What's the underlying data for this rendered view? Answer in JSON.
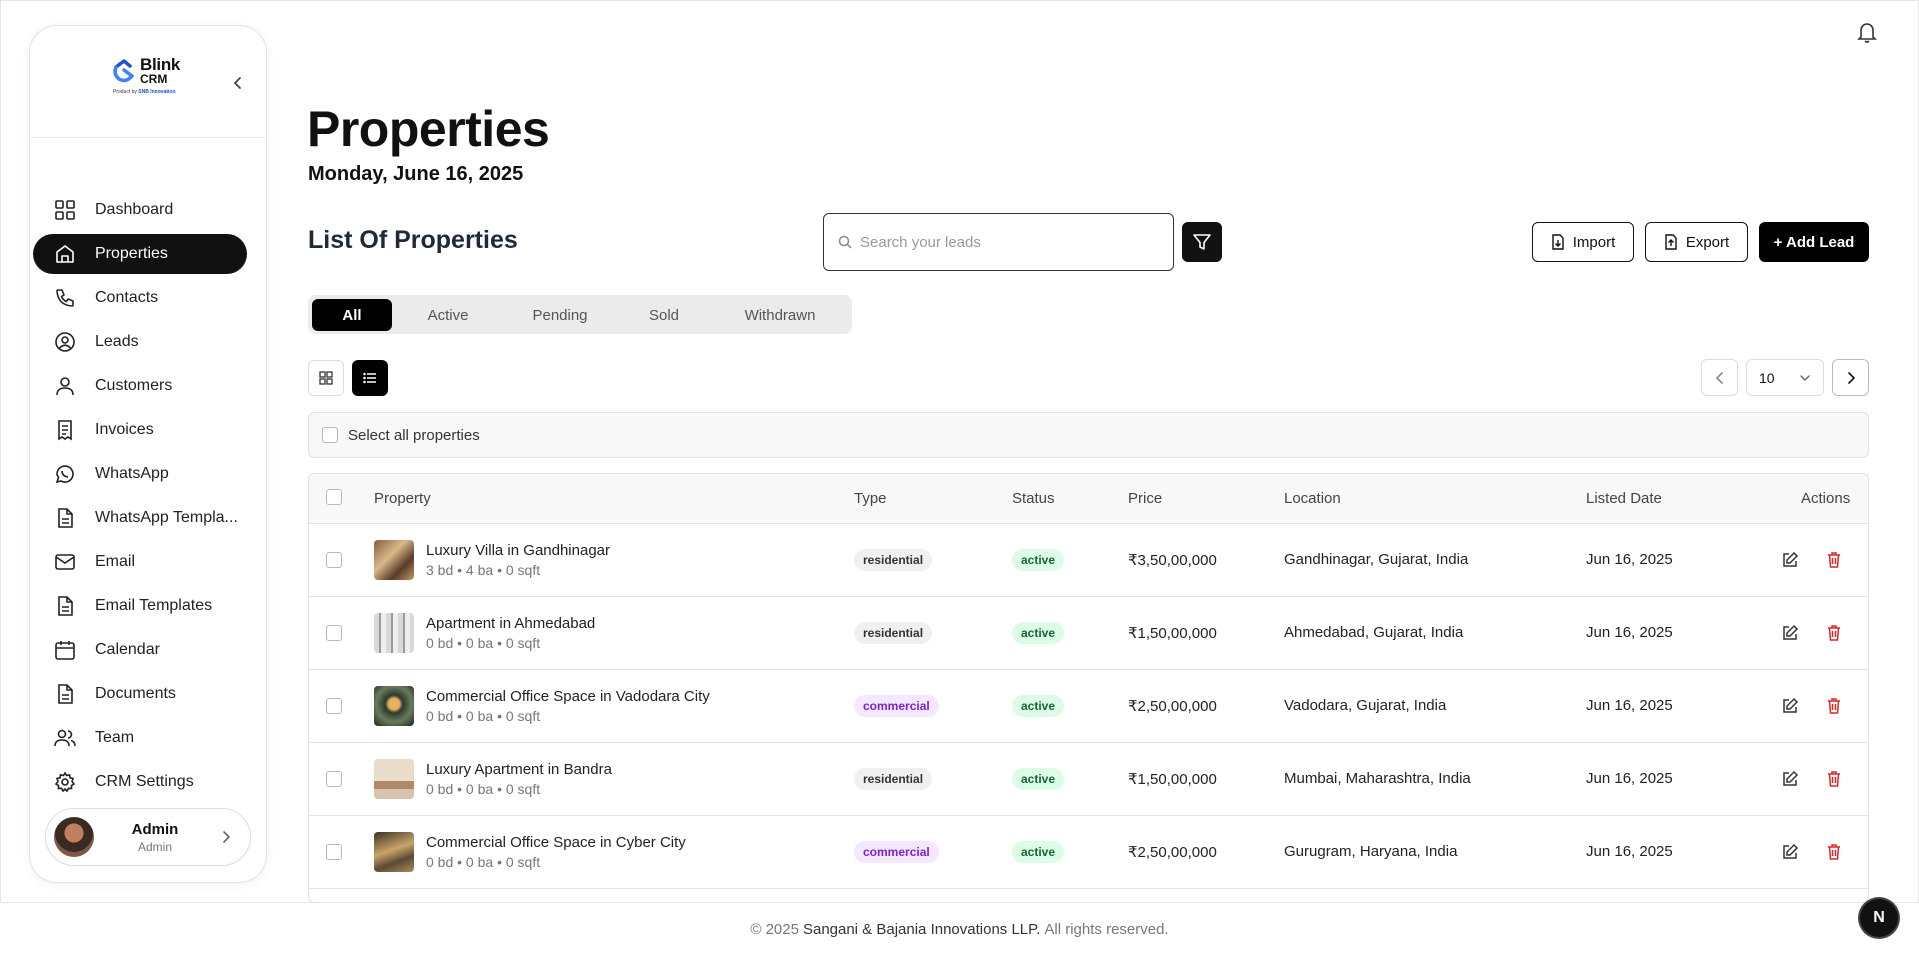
{
  "brand": {
    "name": "Blink",
    "product": "CRM",
    "tagline_prefix": "Product by",
    "tagline_company": "SNB Innovation"
  },
  "sidebar": {
    "items": [
      {
        "label": "Dashboard",
        "icon": "dashboard-icon",
        "active": false
      },
      {
        "label": "Properties",
        "icon": "home-icon",
        "active": true
      },
      {
        "label": "Contacts",
        "icon": "phone-icon",
        "active": false
      },
      {
        "label": "Leads",
        "icon": "leads-icon",
        "active": false
      },
      {
        "label": "Customers",
        "icon": "user-icon",
        "active": false
      },
      {
        "label": "Invoices",
        "icon": "invoice-icon",
        "active": false
      },
      {
        "label": "WhatsApp",
        "icon": "whatsapp-icon",
        "active": false
      },
      {
        "label": "WhatsApp Templa...",
        "icon": "document-icon",
        "active": false
      },
      {
        "label": "Email",
        "icon": "mail-icon",
        "active": false
      },
      {
        "label": "Email Templates",
        "icon": "document-icon",
        "active": false
      },
      {
        "label": "Calendar",
        "icon": "calendar-icon",
        "active": false
      },
      {
        "label": "Documents",
        "icon": "document-icon",
        "active": false
      },
      {
        "label": "Team",
        "icon": "team-icon",
        "active": false
      },
      {
        "label": "CRM Settings",
        "icon": "gear-icon",
        "active": false
      }
    ],
    "user": {
      "name": "Admin",
      "role": "Admin"
    }
  },
  "header": {
    "title": "Properties",
    "date": "Monday, June 16, 2025"
  },
  "list": {
    "title": "List Of Properties",
    "search_placeholder": "Search your leads",
    "import_label": "Import",
    "export_label": "Export",
    "add_label": "+ Add Lead",
    "tabs": [
      "All",
      "Active",
      "Pending",
      "Sold",
      "Withdrawn"
    ],
    "active_tab": "All",
    "page_size": "10",
    "select_all_label": "Select all properties"
  },
  "table": {
    "columns": [
      "Property",
      "Type",
      "Status",
      "Price",
      "Location",
      "Listed Date",
      "Actions"
    ],
    "rows": [
      {
        "name": "Luxury Villa in Gandhinagar",
        "meta": "3 bd • 4 ba • 0 sqft",
        "type": "residential",
        "status": "active",
        "price": "₹3,50,00,000",
        "location": "Gandhinagar, Gujarat, India",
        "date": "Jun 16, 2025"
      },
      {
        "name": "Apartment in Ahmedabad",
        "meta": "0 bd • 0 ba • 0 sqft",
        "type": "residential",
        "status": "active",
        "price": "₹1,50,00,000",
        "location": "Ahmedabad, Gujarat, India",
        "date": "Jun 16, 2025"
      },
      {
        "name": "Commercial Office Space in Vadodara City",
        "meta": "0 bd • 0 ba • 0 sqft",
        "type": "commercial",
        "status": "active",
        "price": "₹2,50,00,000",
        "location": "Vadodara, Gujarat, India",
        "date": "Jun 16, 2025"
      },
      {
        "name": "Luxury Apartment in Bandra",
        "meta": "0 bd • 0 ba • 0 sqft",
        "type": "residential",
        "status": "active",
        "price": "₹1,50,00,000",
        "location": "Mumbai, Maharashtra, India",
        "date": "Jun 16, 2025"
      },
      {
        "name": "Commercial Office Space in Cyber City",
        "meta": "0 bd • 0 ba • 0 sqft",
        "type": "commercial",
        "status": "active",
        "price": "₹2,50,00,000",
        "location": "Gurugram, Haryana, India",
        "date": "Jun 16, 2025"
      }
    ]
  },
  "footer": {
    "prefix": "© 2025",
    "company": "Sangani & Bajania Innovations LLP.",
    "suffix": "All rights reserved."
  },
  "dev_badge": "N",
  "colors": {
    "primary": "#000000",
    "active_badge_bg": "#dcfce7",
    "commercial_badge_bg": "#f3e8ff",
    "delete": "#dc2626"
  }
}
